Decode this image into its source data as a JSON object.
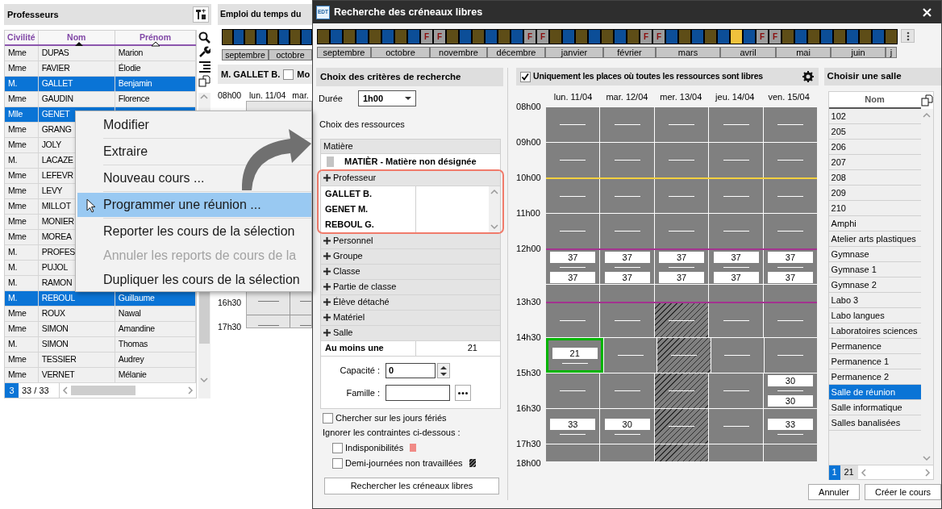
{
  "professors_panel": {
    "title": "Professeurs",
    "columns": [
      {
        "label": "Civilité",
        "sorted": false
      },
      {
        "label": "Nom",
        "sorted": true,
        "primary": true
      },
      {
        "label": "Prénom",
        "sorted": true,
        "primary": false
      }
    ],
    "rows": [
      {
        "civility": "Mme",
        "last_name": "DUPAS",
        "first_name": "Marion",
        "selected": false
      },
      {
        "civility": "Mme",
        "last_name": "FAVIER",
        "first_name": "Élodie",
        "selected": false
      },
      {
        "civility": "M.",
        "last_name": "GALLET",
        "first_name": "Benjamin",
        "selected": true
      },
      {
        "civility": "Mme",
        "last_name": "GAUDIN",
        "first_name": "Florence",
        "selected": false
      },
      {
        "civility": "Mlle",
        "last_name": "GENET",
        "selected": true
      },
      {
        "civility": "Mme",
        "last_name": "GRANG",
        "selected": false
      },
      {
        "civility": "Mme",
        "last_name": "JOLY",
        "selected": false
      },
      {
        "civility": "M.",
        "last_name": "LACAZE",
        "selected": false
      },
      {
        "civility": "Mme",
        "last_name": "LEFEVR",
        "selected": false
      },
      {
        "civility": "Mme",
        "last_name": "LEVY",
        "selected": false
      },
      {
        "civility": "Mme",
        "last_name": "MILLOT",
        "selected": false
      },
      {
        "civility": "Mme",
        "last_name": "MONIER",
        "selected": false
      },
      {
        "civility": "Mme",
        "last_name": "MOREA",
        "selected": false
      },
      {
        "civility": "M.",
        "last_name": "PROFES",
        "selected": false
      },
      {
        "civility": "M.",
        "last_name": "PUJOL",
        "selected": false
      },
      {
        "civility": "M.",
        "last_name": "RAMON",
        "selected": false
      },
      {
        "civility": "M.",
        "last_name": "REBOUL",
        "first_name": "Guillaume",
        "selected": true
      },
      {
        "civility": "Mme",
        "last_name": "ROUX",
        "first_name": "Nawal",
        "selected": false
      },
      {
        "civility": "Mme",
        "last_name": "SIMON",
        "first_name": "Amandine",
        "selected": false
      },
      {
        "civility": "M.",
        "last_name": "SIMON",
        "first_name": "Thomas",
        "selected": false
      },
      {
        "civility": "Mme",
        "last_name": "TESSIER",
        "first_name": "Audrey",
        "selected": false
      },
      {
        "civility": "Mme",
        "last_name": "VERNET",
        "first_name": "Mélanie",
        "selected": false
      }
    ],
    "footer": {
      "badge": "3",
      "count": "33 / 33"
    }
  },
  "timetable_panel": {
    "title": "Emploi du temps du",
    "weeks": [
      {
        "kind": "a"
      },
      {
        "kind": "b"
      },
      {
        "kind": "a"
      },
      {
        "kind": "b"
      },
      {
        "kind": "a"
      },
      {
        "kind": "b"
      },
      {
        "kind": "a"
      },
      {
        "kind": "b"
      }
    ],
    "months": [
      "septembre",
      "octobre"
    ],
    "teacher": "M. GALLET B.",
    "option": {
      "label": "Mo",
      "checked": false
    },
    "days": [
      "lun. 11/04",
      "mar."
    ],
    "times": [
      "08h00",
      "16h30",
      "17h30"
    ]
  },
  "context_menu": {
    "items": [
      {
        "label": "Modifier",
        "selected": false,
        "disabled": false,
        "separator": false
      },
      {
        "label": "Extraire",
        "selected": false,
        "disabled": false,
        "separator": true
      },
      {
        "label": "Nouveau cours ...",
        "selected": false,
        "disabled": false,
        "separator": true
      },
      {
        "label": "Programmer une réunion ...",
        "selected": true,
        "disabled": false,
        "separator": true
      },
      {
        "label": "Reporter les cours de la sélection",
        "selected": false,
        "disabled": false,
        "separator": true
      },
      {
        "label": "Annuler les reports de cours de la",
        "selected": false,
        "disabled": true,
        "separator": false
      },
      {
        "label": "Dupliquer les cours de la sélection",
        "selected": false,
        "disabled": false,
        "separator": false
      }
    ]
  },
  "dialog": {
    "badge": "EDT",
    "title": "Recherche des créneaux libres",
    "weeks": [
      {
        "kind": "a"
      },
      {
        "kind": "b"
      },
      {
        "kind": "a"
      },
      {
        "kind": "b"
      },
      {
        "kind": "a"
      },
      {
        "kind": "b"
      },
      {
        "kind": "a"
      },
      {
        "kind": "b"
      },
      {
        "kind": "holiday",
        "label": "F"
      },
      {
        "kind": "holiday",
        "label": "F"
      },
      {
        "kind": "a"
      },
      {
        "kind": "b"
      },
      {
        "kind": "a"
      },
      {
        "kind": "b"
      },
      {
        "kind": "a"
      },
      {
        "kind": "b"
      },
      {
        "kind": "holiday",
        "label": "F"
      },
      {
        "kind": "holiday",
        "label": "F"
      },
      {
        "kind": "a"
      },
      {
        "kind": "b"
      },
      {
        "kind": "a"
      },
      {
        "kind": "b"
      },
      {
        "kind": "a"
      },
      {
        "kind": "b"
      },
      {
        "kind": "a"
      },
      {
        "kind": "holiday",
        "label": "F"
      },
      {
        "kind": "holiday",
        "label": "F"
      },
      {
        "kind": "b"
      },
      {
        "kind": "a"
      },
      {
        "kind": "b"
      },
      {
        "kind": "a"
      },
      {
        "kind": "b"
      },
      {
        "kind": "current"
      },
      {
        "kind": "b"
      },
      {
        "kind": "holiday",
        "label": "F"
      },
      {
        "kind": "holiday",
        "label": "F"
      },
      {
        "kind": "a"
      },
      {
        "kind": "b"
      },
      {
        "kind": "a"
      },
      {
        "kind": "b"
      },
      {
        "kind": "a"
      },
      {
        "kind": "b"
      },
      {
        "kind": "a"
      },
      {
        "kind": "b"
      },
      {
        "kind": "a"
      }
    ],
    "months": [
      "septembre",
      "octobre",
      "novembre",
      "décembre",
      "janvier",
      "février",
      "mars",
      "avril",
      "mai",
      "juin",
      "j"
    ],
    "criteria": {
      "title": "Choix des critères de recherche",
      "duration_label": "Durée",
      "duration": "1h00",
      "resources_label": "Choix des ressources",
      "subject_header": "Matière",
      "subject": "MATIÈR - Matière non désignée",
      "sections": [
        {
          "label": "Professeur",
          "kind": "list",
          "highlighted": true,
          "rows": [
            {
              "name": "GALLET B."
            },
            {
              "name": "GENET M."
            },
            {
              "name": "REBOUL G."
            }
          ]
        },
        {
          "label": "Personnel",
          "kind": "collapsed",
          "highlighted": false
        },
        {
          "label": "Groupe",
          "kind": "collapsed",
          "highlighted": false
        },
        {
          "label": "Classe",
          "kind": "collapsed",
          "highlighted": false
        },
        {
          "label": "Partie de classe",
          "kind": "collapsed",
          "highlighted": false
        },
        {
          "label": "Élève détaché",
          "kind": "collapsed",
          "highlighted": false
        },
        {
          "label": "Matériel",
          "kind": "collapsed",
          "highlighted": false
        },
        {
          "label": "Salle",
          "kind": "summary",
          "highlighted": false,
          "rows": [
            {
              "name": "Au moins une",
              "count": "21"
            }
          ]
        }
      ],
      "capacity_label": "Capacité :",
      "capacity": "0",
      "family_label": "Famille :",
      "holidays": {
        "label": "Chercher sur les jours fériés",
        "checked": false
      },
      "ignore_label": "Ignorer les contraintes ci-dessous :",
      "ignore_options": [
        {
          "label": "Indisponibilités",
          "checked": false,
          "kind": "unavailable"
        },
        {
          "label": "Demi-journées non travaillées",
          "checked": false,
          "kind": "half_days"
        }
      ],
      "search_button": "Rechercher les créneaux libres"
    },
    "results": {
      "only_free_label": "Uniquement les places où toutes les ressources sont libres",
      "only_free": true,
      "days": [
        "lun. 11/04",
        "mar. 12/04",
        "mer. 13/04",
        "jeu. 14/04",
        "ven. 15/04"
      ],
      "rows": [
        {
          "kind": "hour",
          "time": "08h00",
          "cells": [
            {
              "hatched": false,
              "selected": false
            },
            {
              "hatched": false,
              "selected": false
            },
            {
              "hatched": false,
              "selected": false
            },
            {
              "hatched": false,
              "selected": false
            },
            {
              "hatched": false,
              "selected": false
            }
          ]
        },
        {
          "kind": "hour",
          "time": "09h00",
          "cells": [
            {
              "hatched": false,
              "selected": false
            },
            {
              "hatched": false,
              "selected": false
            },
            {
              "hatched": false,
              "selected": false
            },
            {
              "hatched": false,
              "selected": false
            },
            {
              "hatched": false,
              "selected": false
            }
          ]
        },
        {
          "kind": "hour",
          "time": "10h00",
          "now_line": true,
          "cells": [
            {
              "hatched": false,
              "selected": false
            },
            {
              "hatched": false,
              "selected": false
            },
            {
              "hatched": false,
              "selected": false
            },
            {
              "hatched": false,
              "selected": false
            },
            {
              "hatched": false,
              "selected": false
            }
          ]
        },
        {
          "kind": "hour",
          "time": "11h00",
          "cells": [
            {
              "hatched": false,
              "selected": false
            },
            {
              "hatched": false,
              "selected": false
            },
            {
              "hatched": false,
              "selected": false
            },
            {
              "hatched": false,
              "selected": false
            },
            {
              "hatched": false,
              "selected": false
            }
          ]
        },
        {
          "kind": "hour",
          "time": "12h00",
          "break_line": true,
          "cells": [
            {
              "hatched": false,
              "selected": false,
              "labels": [
                "37",
                "37"
              ]
            },
            {
              "hatched": false,
              "selected": false,
              "labels": [
                "37",
                "37"
              ]
            },
            {
              "hatched": false,
              "selected": false,
              "labels": [
                "37",
                "37"
              ]
            },
            {
              "hatched": false,
              "selected": false,
              "labels": [
                "37",
                "37"
              ]
            },
            {
              "hatched": false,
              "selected": false,
              "labels": [
                "37",
                "37"
              ]
            }
          ]
        },
        {
          "kind": "half",
          "cells": [
            {
              "hatched": false,
              "selected": false
            },
            {
              "hatched": false,
              "selected": false
            },
            {
              "hatched": false,
              "selected": false
            },
            {
              "hatched": false,
              "selected": false
            },
            {
              "hatched": false,
              "selected": false
            }
          ]
        },
        {
          "kind": "hour",
          "time": "13h30",
          "break_line": true,
          "cells": [
            {
              "hatched": false,
              "selected": false
            },
            {
              "hatched": false,
              "selected": false
            },
            {
              "hatched": true,
              "selected": false
            },
            {
              "hatched": false,
              "selected": false
            },
            {
              "hatched": false,
              "selected": false
            }
          ]
        },
        {
          "kind": "hour",
          "time": "14h30",
          "cells": [
            {
              "hatched": false,
              "selected": true,
              "labels": [
                "21"
              ]
            },
            {
              "hatched": false,
              "selected": false
            },
            {
              "hatched": true,
              "selected": false
            },
            {
              "hatched": false,
              "selected": false
            },
            {
              "hatched": false,
              "selected": false
            }
          ]
        },
        {
          "kind": "hour",
          "time": "15h30",
          "cells": [
            {
              "hatched": false,
              "selected": false
            },
            {
              "hatched": false,
              "selected": false
            },
            {
              "hatched": true,
              "selected": false
            },
            {
              "hatched": false,
              "selected": false
            },
            {
              "hatched": false,
              "selected": false,
              "labels": [
                "30",
                "30"
              ]
            }
          ]
        },
        {
          "kind": "hour",
          "time": "16h30",
          "cells": [
            {
              "hatched": false,
              "selected": false,
              "labels": [
                "33"
              ]
            },
            {
              "hatched": false,
              "selected": false,
              "labels": [
                "30"
              ]
            },
            {
              "hatched": true,
              "selected": false
            },
            {
              "hatched": false,
              "selected": false
            },
            {
              "hatched": false,
              "selected": false,
              "labels": [
                "33"
              ]
            }
          ]
        },
        {
          "kind": "half",
          "time": "17h30",
          "cells": [
            {
              "hatched": false,
              "selected": false
            },
            {
              "hatched": false,
              "selected": false
            },
            {
              "hatched": true,
              "selected": false
            },
            {
              "hatched": false,
              "selected": false
            },
            {
              "hatched": false,
              "selected": false
            }
          ]
        }
      ],
      "end_time": "18h00"
    },
    "rooms": {
      "title": "Choisir une salle",
      "column": "Nom",
      "items": [
        {
          "name": "102",
          "selected": false
        },
        {
          "name": "205",
          "selected": false
        },
        {
          "name": "206",
          "selected": false
        },
        {
          "name": "207",
          "selected": false
        },
        {
          "name": "208",
          "selected": false
        },
        {
          "name": "209",
          "selected": false
        },
        {
          "name": "210",
          "selected": false
        },
        {
          "name": "Amphi",
          "selected": false
        },
        {
          "name": "Atelier arts plastiques",
          "selected": false
        },
        {
          "name": "Gymnase",
          "selected": false
        },
        {
          "name": "Gymnase 1",
          "selected": false
        },
        {
          "name": "Gymnase 2",
          "selected": false
        },
        {
          "name": "Labo 3",
          "selected": false
        },
        {
          "name": "Labo langues",
          "selected": false
        },
        {
          "name": "Laboratoires sciences",
          "selected": false
        },
        {
          "name": "Permanence",
          "selected": false
        },
        {
          "name": "Permanence 1",
          "selected": false
        },
        {
          "name": "Permanence 2",
          "selected": false
        },
        {
          "name": "Salle de réunion",
          "selected": true
        },
        {
          "name": "Salle informatique",
          "selected": false
        },
        {
          "name": "Salles banalisées",
          "selected": false
        }
      ],
      "footer": {
        "badge": "1",
        "count": "21"
      }
    },
    "buttons": [
      "Annuler",
      "Créer le cours"
    ]
  }
}
